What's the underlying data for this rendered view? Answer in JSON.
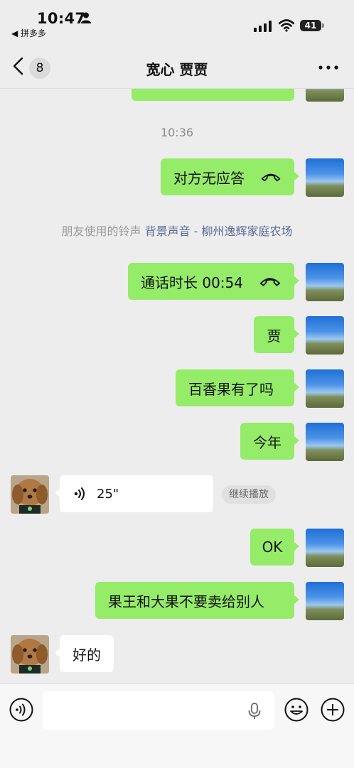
{
  "status_bar": {
    "time": "10:47",
    "back_app": "◀ 拼多多",
    "battery": "41"
  },
  "nav": {
    "unread_count": "8",
    "title": "宽心 贾贾"
  },
  "chat": {
    "timestamp": "10:36",
    "no_answer": "对方无应答",
    "ringtone_prefix": "朋友使用的铃声 ",
    "ringtone_link": "背景声音 - 柳州逸辉家庭农场",
    "call_duration": "通话时长 00:54",
    "msg_jia": "贾",
    "msg_passionfruit": "百香果有了吗",
    "msg_this_year": "今年",
    "voice_duration": "25\"",
    "continue_play": "继续播放",
    "msg_ok": "OK",
    "msg_dont_sell": "果王和大果不要卖给别人",
    "msg_ok_reply": "好的"
  },
  "input": {
    "value": "",
    "placeholder": ""
  },
  "colors": {
    "my_bubble": "#95ec69",
    "their_bubble": "#ffffff",
    "background": "#ededed",
    "link": "#576b95"
  },
  "icons": [
    "person-icon",
    "signal-icon",
    "wifi-icon",
    "back-chevron-icon",
    "more-icon",
    "call-end-icon",
    "voice-wave-icon",
    "voice-input-icon",
    "mic-icon",
    "emoji-icon",
    "plus-icon"
  ]
}
